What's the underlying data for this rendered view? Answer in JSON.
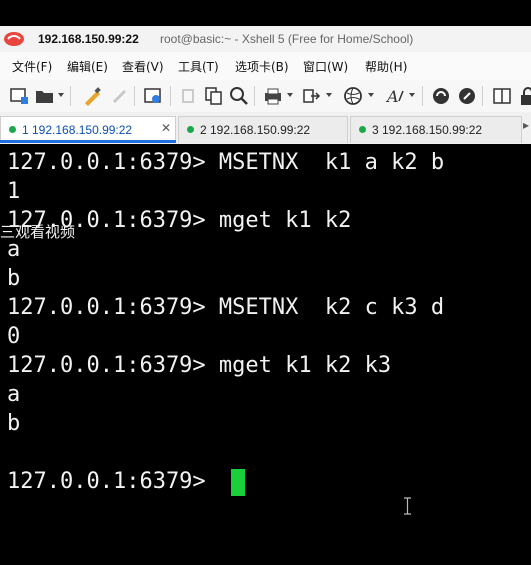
{
  "window": {
    "host": "192.168.150.99:22",
    "title_rest": "root@basic:~ - Xshell 5 (Free for Home/School)"
  },
  "menu": [
    "文件(F)",
    "编辑(E)",
    "查看(V)",
    "工具(T)",
    "选项卡(B)",
    "窗口(W)",
    "帮助(H)"
  ],
  "toolbar_icons": [
    "new-session-icon",
    "open-folder-icon",
    "pen-icon",
    "properties-icon",
    "copy-icon",
    "find-icon",
    "print-icon",
    "transfer-icon",
    "globe-icon",
    "font-icon",
    "xftp-icon",
    "compose-icon",
    "layout-icon"
  ],
  "tabs": [
    {
      "label": "1 192.168.150.99:22",
      "active": true
    },
    {
      "label": "2 192.168.150.99:22",
      "active": false
    },
    {
      "label": "3 192.168.150.99:22",
      "active": false
    }
  ],
  "terminal": {
    "lines": [
      "127.0.0.1:6379> MSETNX  k1 a k2 b",
      "1",
      "127.0.0.1:6379> mget k1 k2",
      "a",
      "b",
      "127.0.0.1:6379> MSETNX  k2 c k3 d",
      "0",
      "127.0.0.1:6379> mget k1 k2 k3",
      "a",
      "b",
      "",
      "127.0.0.1:6379> "
    ],
    "overlay": "三观看视频"
  },
  "colors": {
    "cursor": "#19d03a",
    "active_tab_accent": "#1f6fe0",
    "status_dot": "#1aa84a"
  }
}
